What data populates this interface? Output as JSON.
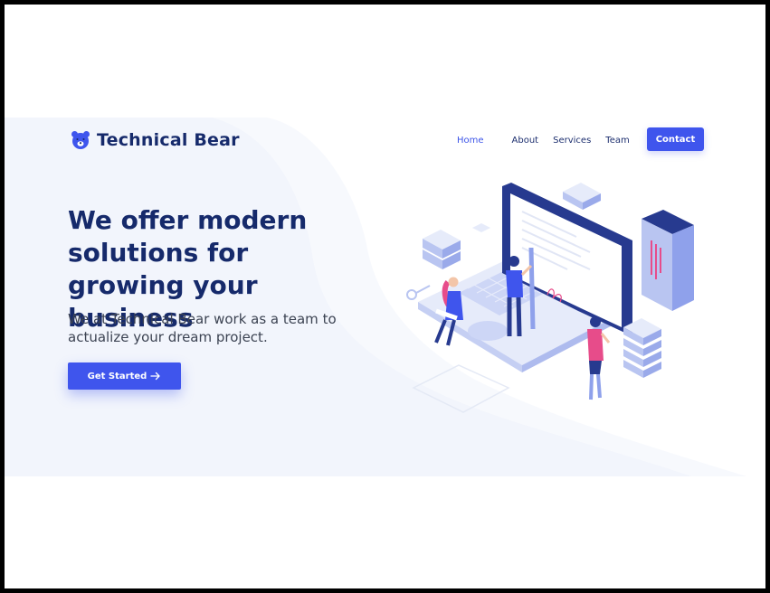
{
  "brand": {
    "name": "Technical Bear",
    "logo_icon": "bear-icon"
  },
  "nav": {
    "links": [
      "Home",
      "About",
      "Services",
      "Team"
    ],
    "active": "Home",
    "contact_label": "Contact"
  },
  "hero": {
    "title": "We offer modern solutions for growing your business",
    "subtitle": "We at Technical Bear work as a team to actualize your dream project.",
    "cta_label": "Get Started",
    "cta_icon": "arrow-right-icon"
  },
  "colors": {
    "primary": "#3f55ed",
    "navy": "#162a6b",
    "hero_bg": "#f2f5fc"
  },
  "illustration": "isometric-team-laptop-illustration"
}
